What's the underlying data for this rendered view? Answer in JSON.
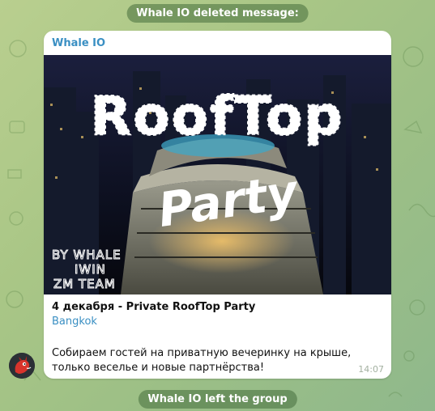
{
  "service": {
    "deleted": "Whale IO deleted message:",
    "left": "Whale IO left the group"
  },
  "message": {
    "sender": "Whale IO",
    "photo": {
      "title_main": "RoofTop",
      "title_script": "Party",
      "credit_lines": [
        "BY WHALE",
        "IWIN",
        "ZM TEAM"
      ]
    },
    "title": "4 декабря - Private RoofTop Party",
    "location": "Bangkok",
    "body": "Собираем гостей на приватную вечеринку на крыше, только веселье и новые партнёрства!",
    "time": "14:07"
  },
  "colors": {
    "accent": "#3a8fc3",
    "wallpaper": "#a9c686",
    "bubble": "#ffffff"
  },
  "icons": {
    "avatar": "red-dragon-avatar"
  }
}
